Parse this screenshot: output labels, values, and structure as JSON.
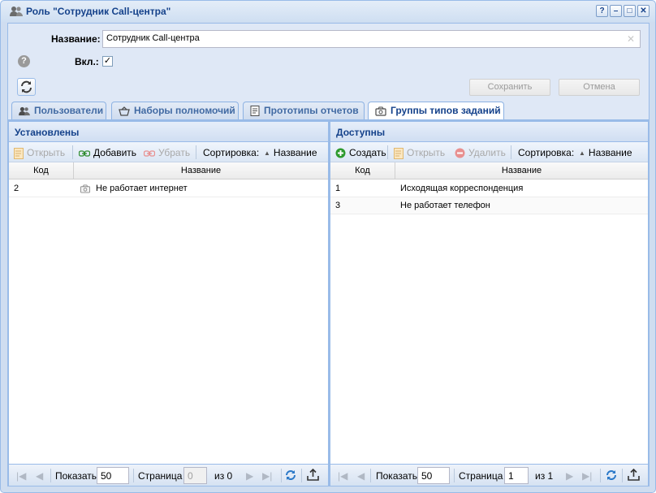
{
  "window": {
    "title": "Роль \"Сотрудник Call-центра\"",
    "buttons": [
      "?",
      "–",
      "□",
      "✕"
    ]
  },
  "form": {
    "name_label": "Название:",
    "name_value": "Сотрудник Call-центра",
    "enabled_label": "Вкл.:",
    "enabled_checked": "✓",
    "save_label": "Сохранить",
    "cancel_label": "Отмена"
  },
  "tabs": [
    {
      "label": "Пользователи",
      "icon": "users-icon"
    },
    {
      "label": "Наборы полномочий",
      "icon": "basket-icon"
    },
    {
      "label": "Прототипы отчетов",
      "icon": "report-icon"
    },
    {
      "label": "Группы типов заданий",
      "icon": "camera-icon",
      "active": true
    }
  ],
  "left": {
    "title": "Установлены",
    "toolbar": {
      "open": "Открыть",
      "add": "Добавить",
      "remove": "Убрать",
      "sort_label": "Сортировка:",
      "sort_field": "Название"
    },
    "columns": [
      "Код",
      "Название"
    ],
    "rows": [
      {
        "code": "2",
        "name": "Не работает интернет"
      }
    ],
    "pager": {
      "show_label": "Показать",
      "page_size": "50",
      "page_label": "Страница",
      "page": "0",
      "of": "из 0"
    }
  },
  "right": {
    "title": "Доступны",
    "toolbar": {
      "create": "Создать",
      "open": "Открыть",
      "delete": "Удалить",
      "sort_label": "Сортировка:",
      "sort_field": "Название"
    },
    "columns": [
      "Код",
      "Название"
    ],
    "rows": [
      {
        "code": "1",
        "name": "Исходящая корреспонденция"
      },
      {
        "code": "3",
        "name": "Не работает телефон"
      }
    ],
    "pager": {
      "show_label": "Показать",
      "page_size": "50",
      "page_label": "Страница",
      "page": "1",
      "of": "из 1"
    }
  },
  "colors": {
    "accent": "#15428b",
    "border": "#99bbe8",
    "panel": "#dfe8f6"
  }
}
